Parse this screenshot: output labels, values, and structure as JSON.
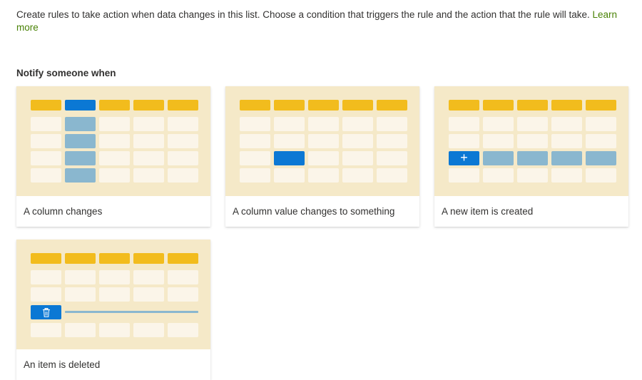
{
  "intro": {
    "text": "Create rules to take action when data changes in this list. Choose a condition that triggers the rule and the action that the rule will take.",
    "link": "Learn more"
  },
  "section": {
    "title": "Notify someone when"
  },
  "cards": [
    {
      "label": "A column changes"
    },
    {
      "label": "A column value changes to something"
    },
    {
      "label": "A new item is created"
    },
    {
      "label": "An item is deleted"
    }
  ],
  "icons": {
    "plus": "+",
    "trash": "trash-icon"
  },
  "colors": {
    "header": "#f2bc1d",
    "accent": "#0b78d4",
    "highlight": "#8ab7cf",
    "cell": "#fbf5e9",
    "card_bg": "#f5e9c8",
    "link": "#498205"
  }
}
